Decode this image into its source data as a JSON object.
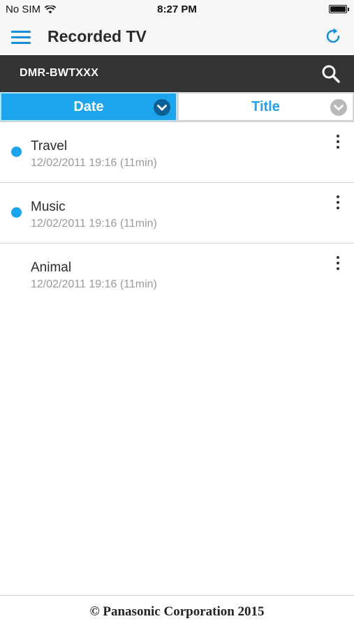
{
  "status_bar": {
    "carrier": "No SIM",
    "time": "8:27 PM"
  },
  "header": {
    "title": "Recorded TV"
  },
  "device": {
    "name": "DMR-BWTXXX"
  },
  "sort_tabs": [
    {
      "label": "Date",
      "active": true
    },
    {
      "label": "Title",
      "active": false
    }
  ],
  "recordings": [
    {
      "title": "Travel",
      "meta": "12/02/2011 19:16 (11min)",
      "new": true
    },
    {
      "title": "Music",
      "meta": "12/02/2011 19:16 (11min)",
      "new": true
    },
    {
      "title": "Animal",
      "meta": "12/02/2011 19:16 (11min)",
      "new": false
    }
  ],
  "footer": {
    "copyright": "© Panasonic Corporation 2015"
  },
  "colors": {
    "accent": "#1ca4ec",
    "device_bar": "#333333",
    "link_blue": "#1a8fd6"
  }
}
